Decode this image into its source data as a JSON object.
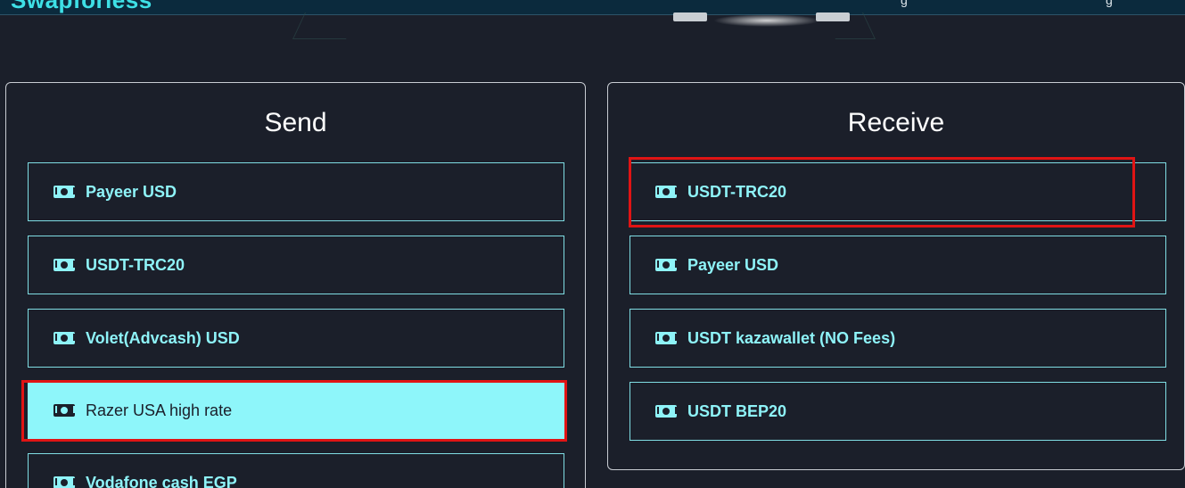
{
  "header": {
    "logo_text": "Swapforless",
    "nav_a": "g",
    "nav_b": "g"
  },
  "send": {
    "title": "Send",
    "options": [
      {
        "label": "Payeer USD",
        "icon": "money-icon"
      },
      {
        "label": "USDT-TRC20",
        "icon": "money-icon"
      },
      {
        "label": "Volet(Advcash) USD",
        "icon": "money-icon"
      },
      {
        "label": "Razer USA high rate",
        "icon": "money-icon",
        "selected": true
      },
      {
        "label": "Vodafone cash EGP",
        "icon": "money-icon"
      }
    ]
  },
  "receive": {
    "title": "Receive",
    "options": [
      {
        "label": "USDT-TRC20",
        "icon": "money-icon",
        "highlighted": true
      },
      {
        "label": "Payeer USD",
        "icon": "money-icon"
      },
      {
        "label": "USDT kazawallet (NO Fees)",
        "icon": "money-icon"
      },
      {
        "label": "USDT BEP20",
        "icon": "money-icon"
      }
    ]
  },
  "colors": {
    "background": "#1b1f2a",
    "accent": "#8ef3f8",
    "highlight": "#e01414"
  }
}
